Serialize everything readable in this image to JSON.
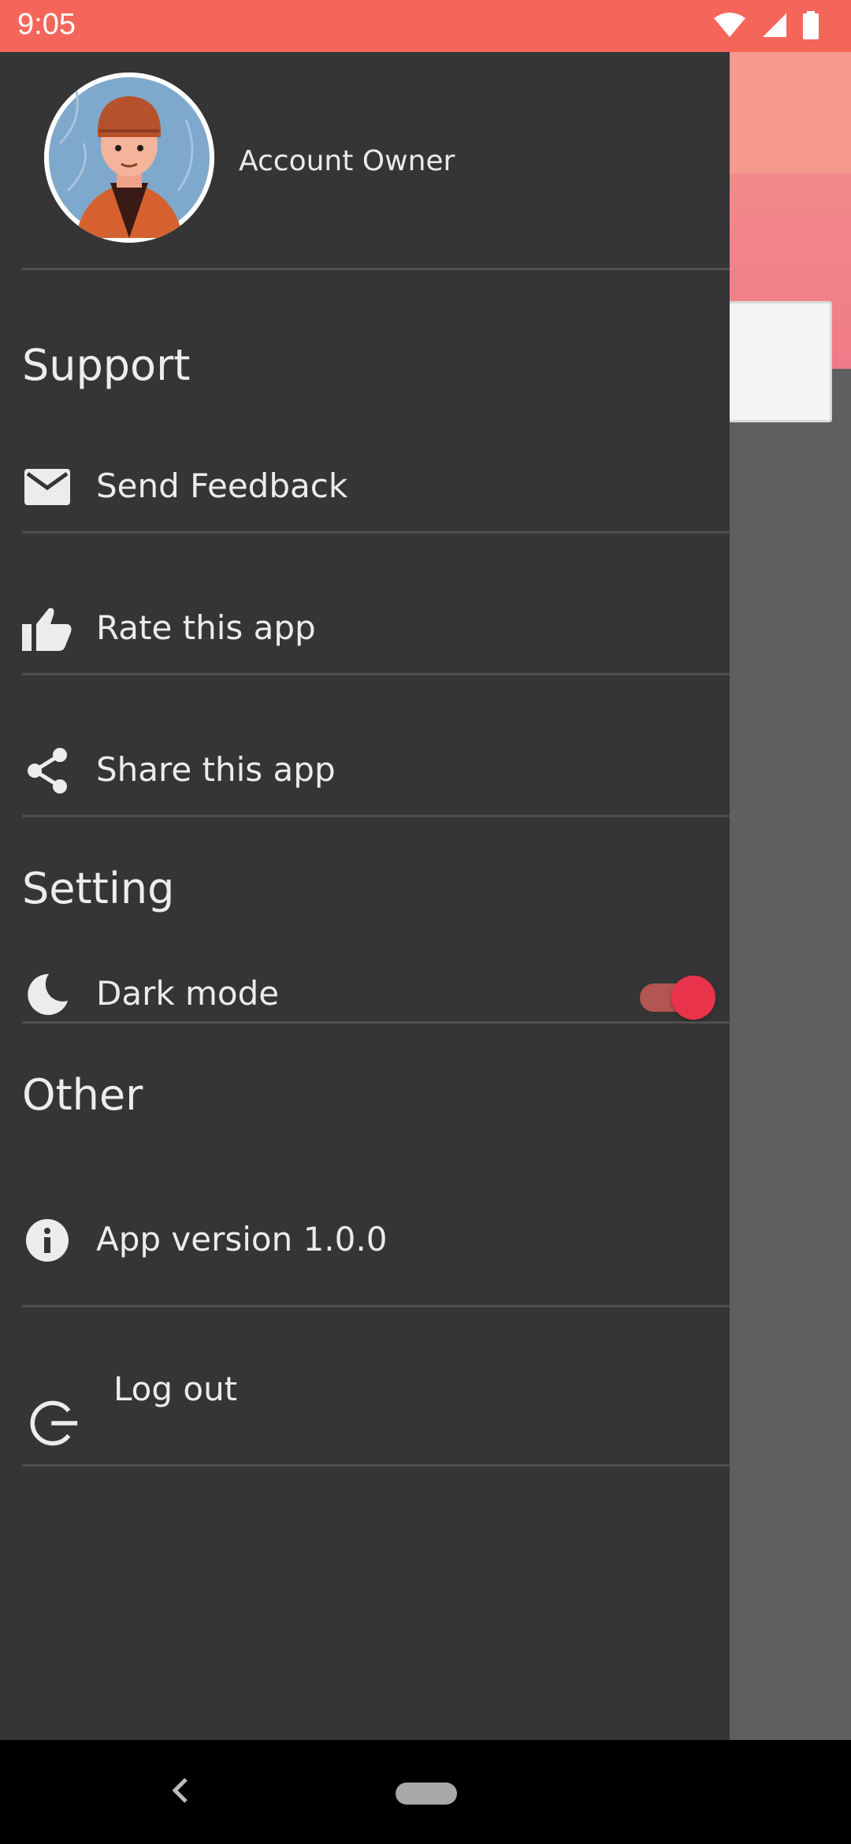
{
  "status_bar": {
    "time": "9:05",
    "icons": [
      "wifi-icon",
      "cell-signal-icon",
      "battery-icon"
    ]
  },
  "profile": {
    "name": "Account Owner"
  },
  "sections": {
    "support": "Support",
    "setting": "Setting",
    "other": "Other"
  },
  "menu": {
    "send_feedback": "Send Feedback",
    "rate_app": "Rate this app",
    "share_app": "Share this app",
    "dark_mode": "Dark mode",
    "app_version": "App version 1.0.0",
    "log_out": "Log out"
  },
  "dark_mode_enabled": true,
  "colors": {
    "status_bar": "#f5665a",
    "drawer_bg": "#353535",
    "accent": "#e8334a"
  }
}
